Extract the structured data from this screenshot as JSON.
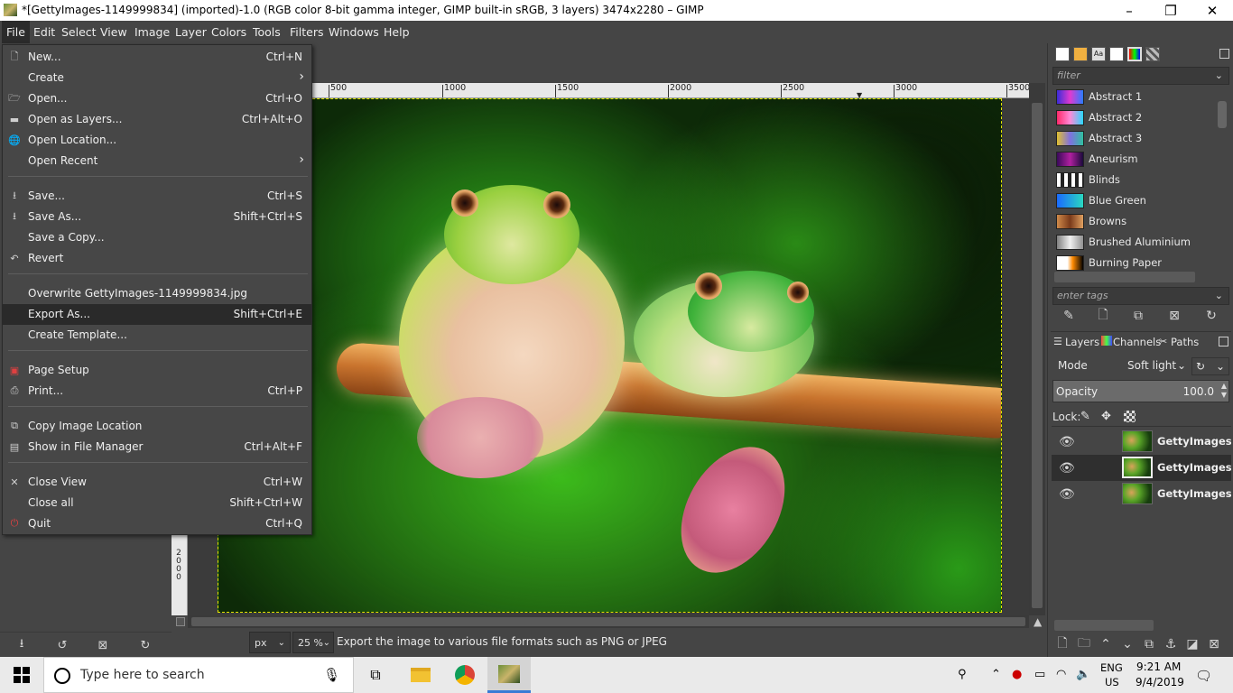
{
  "window": {
    "title": "*[GettyImages-1149999834] (imported)-1.0 (RGB color 8-bit gamma integer, GIMP built-in sRGB, 3 layers) 3474x2280 – GIMP",
    "minimize_icon": "minimize-icon",
    "maximize_icon": "restore-icon",
    "close_icon": "close-icon"
  },
  "menubar": {
    "items": [
      "File",
      "Edit",
      "Select",
      "View",
      "Image",
      "Layer",
      "Colors",
      "Tools",
      "Filters",
      "Windows",
      "Help"
    ],
    "selected": "File"
  },
  "file_menu": {
    "items": [
      {
        "label": "New...",
        "shortcut": "Ctrl+N",
        "icon": "new-icon"
      },
      {
        "label": "Create",
        "shortcut": "",
        "icon": "",
        "submenu": true
      },
      {
        "label": "Open...",
        "shortcut": "Ctrl+O",
        "icon": "open-icon"
      },
      {
        "label": "Open as Layers...",
        "shortcut": "Ctrl+Alt+O",
        "icon": "open-layers-icon"
      },
      {
        "label": "Open Location...",
        "shortcut": "",
        "icon": "globe-icon"
      },
      {
        "label": "Open Recent",
        "shortcut": "",
        "icon": "",
        "submenu": true
      },
      {
        "label": "Save...",
        "shortcut": "Ctrl+S",
        "icon": "save-icon"
      },
      {
        "label": "Save As...",
        "shortcut": "Shift+Ctrl+S",
        "icon": "save-as-icon"
      },
      {
        "label": "Save a Copy...",
        "shortcut": "",
        "icon": ""
      },
      {
        "label": "Revert",
        "shortcut": "",
        "icon": "revert-icon"
      },
      {
        "label": "Overwrite GettyImages-1149999834.jpg",
        "shortcut": "",
        "icon": ""
      },
      {
        "label": "Export As...",
        "shortcut": "Shift+Ctrl+E",
        "icon": "",
        "highlighted": true
      },
      {
        "label": "Create Template...",
        "shortcut": "",
        "icon": ""
      },
      {
        "label": "Page Setup",
        "shortcut": "",
        "icon": "page-setup-icon"
      },
      {
        "label": "Print...",
        "shortcut": "Ctrl+P",
        "icon": "print-icon"
      },
      {
        "label": "Copy Image Location",
        "shortcut": "",
        "icon": "copy-location-icon"
      },
      {
        "label": "Show in File Manager",
        "shortcut": "Ctrl+Alt+F",
        "icon": "file-manager-icon"
      },
      {
        "label": "Close View",
        "shortcut": "Ctrl+W",
        "icon": "close-view-icon"
      },
      {
        "label": "Close all",
        "shortcut": "Shift+Ctrl+W",
        "icon": ""
      },
      {
        "label": "Quit",
        "shortcut": "Ctrl+Q",
        "icon": "quit-icon"
      }
    ]
  },
  "ruler": {
    "h_labels": [
      "500",
      "1000",
      "1500",
      "2000",
      "2500",
      "3000",
      "3500"
    ],
    "v_labels": [
      "2",
      "0",
      "0",
      "0"
    ]
  },
  "statusbar": {
    "unit": "px",
    "zoom": "25 %",
    "message": "Export the image to various file formats such as PNG or JPEG"
  },
  "gradients": {
    "filter_placeholder": "filter",
    "tags_placeholder": "enter tags",
    "items": [
      {
        "name": "Abstract 1",
        "colors": [
          "#3a2bd8",
          "#e03ad0",
          "#2a7cff"
        ]
      },
      {
        "name": "Abstract 2",
        "colors": [
          "#ff2a6a",
          "#ff8ad8",
          "#2ad8ff"
        ]
      },
      {
        "name": "Abstract 3",
        "colors": [
          "#e0c030",
          "#8070e0",
          "#30c0a0"
        ]
      },
      {
        "name": "Aneurism",
        "colors": [
          "#3a0a5a",
          "#b020a0",
          "#1a0a3a"
        ]
      },
      {
        "name": "Blinds",
        "colors": [
          "#ffffff",
          "#222222",
          "#ffffff"
        ]
      },
      {
        "name": "Blue Green",
        "colors": [
          "#1a6aff",
          "#2ad8c0"
        ]
      },
      {
        "name": "Browns",
        "colors": [
          "#d08a4a",
          "#7a3a1a",
          "#e0a060"
        ]
      },
      {
        "name": "Brushed Aluminium",
        "colors": [
          "#808080",
          "#f0f0f0",
          "#909090"
        ]
      },
      {
        "name": "Burning Paper",
        "colors": [
          "#ffffff",
          "#ff8a00",
          "#000000"
        ]
      }
    ]
  },
  "layers_panel": {
    "tabs": [
      "Layers",
      "Channels",
      "Paths"
    ],
    "mode_label": "Mode",
    "mode_value": "Soft light",
    "opacity_label": "Opacity",
    "opacity_value": "100.0",
    "lock_label": "Lock:",
    "layers": [
      {
        "name": "GettyImages-",
        "visible": true,
        "selected": false
      },
      {
        "name": "GettyImages-",
        "visible": true,
        "selected": true
      },
      {
        "name": "GettyImages-",
        "visible": true,
        "selected": false
      }
    ]
  },
  "taskbar": {
    "search_placeholder": "Type here to search",
    "lang": "ENG",
    "region": "US",
    "time": "9:21 AM",
    "date": "9/4/2019"
  }
}
